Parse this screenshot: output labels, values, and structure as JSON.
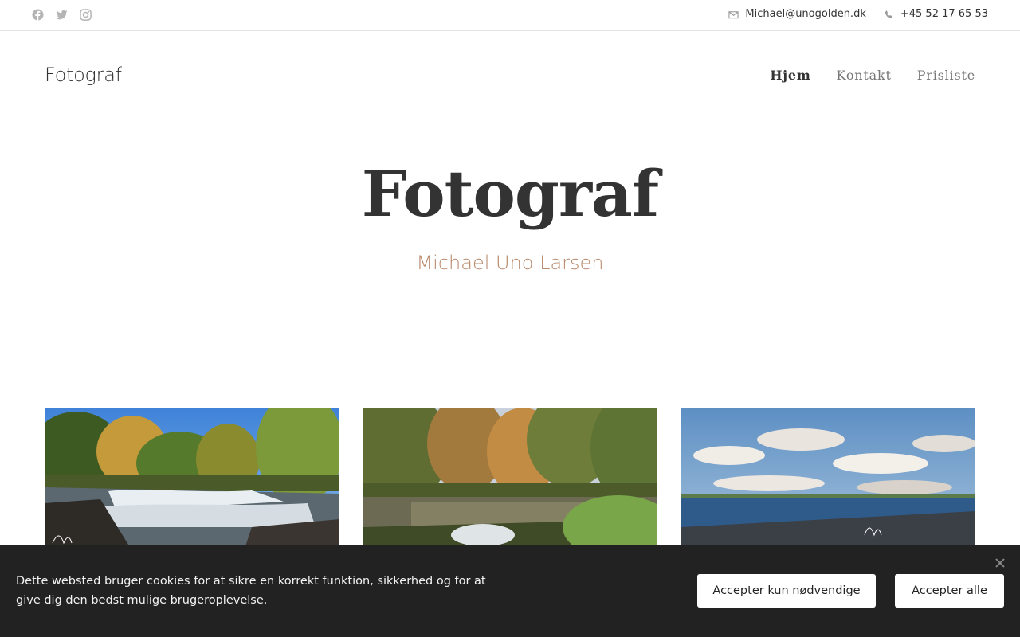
{
  "topbar": {
    "social": [
      {
        "icon": "facebook-icon"
      },
      {
        "icon": "twitter-icon"
      },
      {
        "icon": "instagram-icon"
      }
    ],
    "email": "Michael@unogolden.dk",
    "phone": "+45 52 17 65 53"
  },
  "header": {
    "logo": "Fotograf",
    "nav": [
      {
        "label": "Hjem",
        "active": true
      },
      {
        "label": "Kontakt",
        "active": false
      },
      {
        "label": "Prisliste",
        "active": false
      }
    ]
  },
  "hero": {
    "title": "Fotograf",
    "subtitle": "Michael Uno Larsen"
  },
  "gallery": [
    {
      "subject": "waterfall-in-forest"
    },
    {
      "subject": "forest-stream-autumn"
    },
    {
      "subject": "beach-coastline"
    }
  ],
  "cookie_banner": {
    "message": "Dette websted bruger cookies for at sikre en korrekt funktion, sikkerhed og for at give dig den bedst mulige brugeroplevelse.",
    "accept_necessary_label": "Accepter kun nødvendige",
    "accept_all_label": "Accepter alle"
  },
  "colors": {
    "accent": "#b9896a",
    "text": "#333333",
    "cookie_bg": "#222222"
  }
}
